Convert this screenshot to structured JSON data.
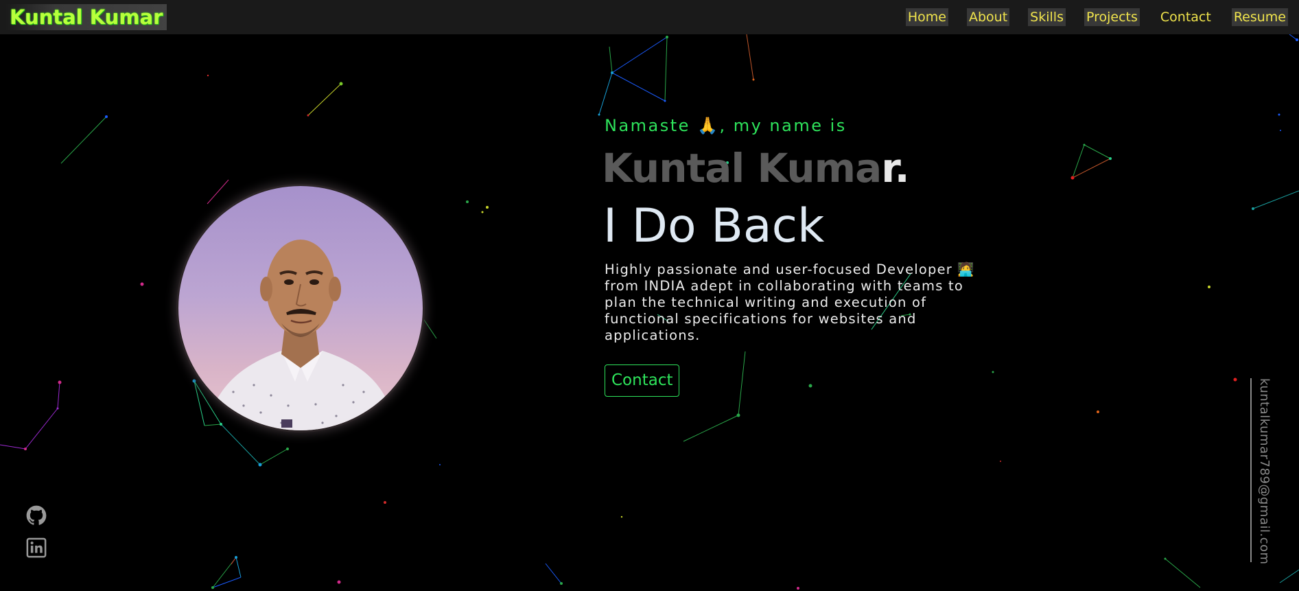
{
  "navbar": {
    "logo": "Kuntal Kumar",
    "links": [
      {
        "label": "Home"
      },
      {
        "label": "About"
      },
      {
        "label": "Skills"
      },
      {
        "label": "Projects"
      },
      {
        "label": "Contact"
      },
      {
        "label": "Resume"
      }
    ]
  },
  "hero": {
    "greeting": "Namaste 🙏, my name is",
    "name_main": "Kuntal Kuma",
    "name_tail": "r.",
    "tagline": "I Do Back",
    "bio": "Highly passionate and user-focused Developer 🧑‍💻 from INDIA adept in collaborating with teams to plan the technical writing and execution of functional specifications for websites and applications.",
    "contact_button": "Contact"
  },
  "profile": {
    "avatar_icon": "profile-photo"
  },
  "socials": [
    {
      "icon": "github-icon"
    },
    {
      "icon": "linkedin-icon"
    }
  ],
  "email": "kuntalkumar789@gmail.com",
  "colors": {
    "accent_green": "#2ee35b",
    "nav_yellow": "#f0e44c",
    "logo_green": "#b8ff3c",
    "background": "#000000",
    "navbar_bg": "#1a1a1a"
  }
}
